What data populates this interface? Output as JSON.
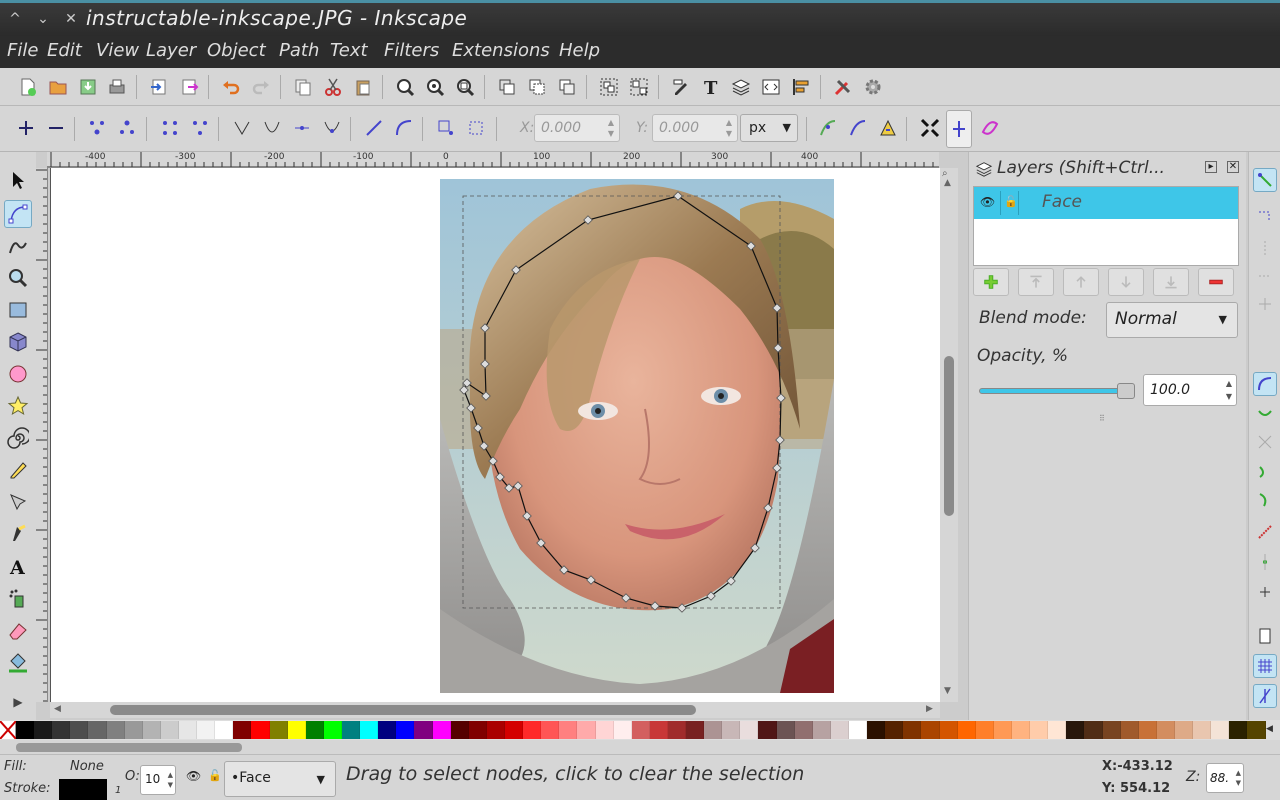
{
  "window": {
    "title": "instructable-inkscape.JPG - Inkscape",
    "controls": [
      "^",
      "v",
      "x"
    ]
  },
  "menu": [
    "File",
    "Edit",
    "View",
    "Layer",
    "Object",
    "Path",
    "Text",
    "Filters",
    "Extensions",
    "Help"
  ],
  "tool_controls": {
    "x_label": "X:",
    "x_value": "0.000",
    "y_label": "Y:",
    "y_value": "0.000",
    "unit": "px"
  },
  "rulers": {
    "top_ticks": [
      "-400",
      "-300",
      "-200",
      "-100",
      "0",
      "100",
      "200",
      "300",
      "400"
    ],
    "left_ticks": [
      "300",
      "400",
      "500",
      "600",
      "700",
      "800"
    ]
  },
  "toolbox": {
    "active_tool": "node-tool",
    "tools": [
      "select-tool",
      "node-tool",
      "tweak-tool",
      "zoom-tool",
      "rectangle-tool",
      "3d-box-tool",
      "ellipse-tool",
      "star-tool",
      "spiral-tool",
      "pencil-tool",
      "pen-tool",
      "calligraphy-tool",
      "text-tool",
      "spray-tool",
      "eraser-tool",
      "paint-bucket-tool"
    ]
  },
  "layers_dock": {
    "title": "Layers (Shift+Ctrl...",
    "layers": [
      {
        "name": "Face",
        "visible": true,
        "locked": false,
        "selected": true
      }
    ],
    "blend_label": "Blend mode:",
    "blend_value": "Normal",
    "opacity_label": "Opacity, %",
    "opacity_value": "100.0",
    "opacity_fraction": 1.0
  },
  "status": {
    "fill_label": "Fill:",
    "fill_value": "None",
    "stroke_label": "Stroke:",
    "stroke_width": "1",
    "opacity_label": "O:",
    "opacity_value": "10",
    "current_layer": "•Face",
    "message": "Drag to select nodes, click to clear the selection",
    "cursor_x": "X:-433.12",
    "cursor_y": "Y: 554.12",
    "zoom_label": "Z:",
    "zoom_value": "88."
  },
  "colors": {
    "accent": "#3ec6e8",
    "active_tool_bg": "#c3e4f4",
    "titlebar": "#2b2b2b",
    "canvas": "#ffffff",
    "panel": "#d6d6d6"
  },
  "palette": [
    "#000000",
    "#1a1a1a",
    "#333333",
    "#4d4d4d",
    "#666666",
    "#808080",
    "#999999",
    "#b3b3b3",
    "#cccccc",
    "#e6e6e6",
    "#f2f2f2",
    "#ffffff",
    "#800000",
    "#ff0000",
    "#808000",
    "#ffff00",
    "#008000",
    "#00ff00",
    "#008080",
    "#00ffff",
    "#000080",
    "#0000ff",
    "#800080",
    "#ff00ff",
    "#550000",
    "#800000",
    "#aa0000",
    "#d40000",
    "#ff2a2a",
    "#ff5555",
    "#ff8080",
    "#ffaaaa",
    "#ffd5d5",
    "#ffeeee",
    "#d35f5f",
    "#c83737",
    "#a02c2c",
    "#782121",
    "#ac9393",
    "#c8b7b7",
    "#e9dddd",
    "#501616",
    "#6c5353",
    "#916f6f",
    "#b7a2a2",
    "#dbcfcf",
    "#ffffff",
    "#2b1100",
    "#552200",
    "#803300",
    "#aa4400",
    "#d45500",
    "#ff6600",
    "#ff7f2a",
    "#ff9955",
    "#ffb380",
    "#ffccaa",
    "#ffe6d5",
    "#28170b",
    "#502d16",
    "#784421",
    "#a05a2c",
    "#c87137",
    "#d38d5f",
    "#deaa87",
    "#e9c6af",
    "#f4e3d7",
    "#2b2200",
    "#554400"
  ]
}
